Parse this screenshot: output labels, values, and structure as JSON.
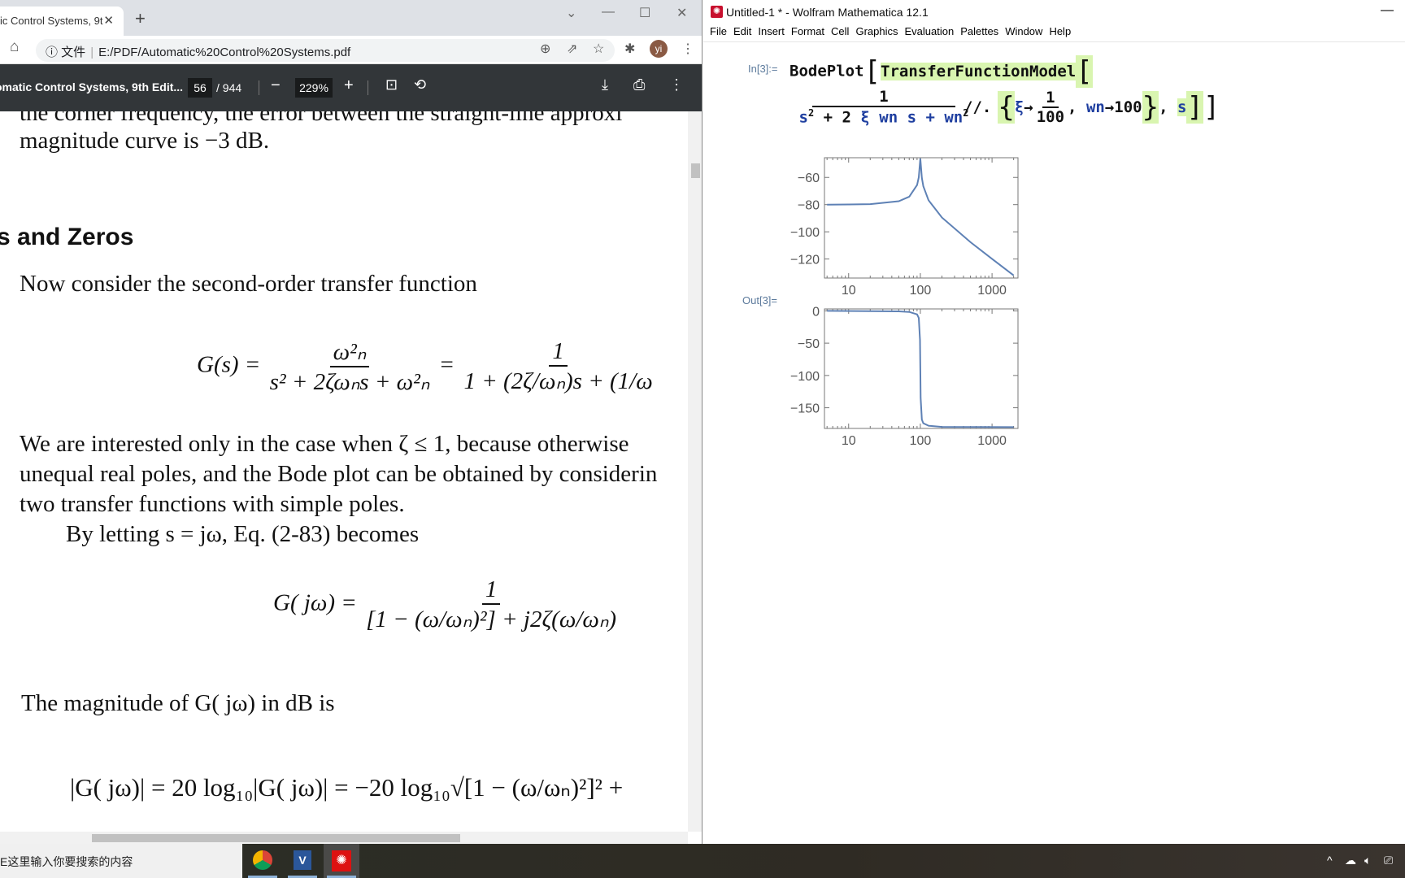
{
  "chrome": {
    "tab_title": "ic Control Systems, 9t",
    "new_tab": "+",
    "window_controls": [
      "⌄",
      "—",
      "☐",
      "✕"
    ],
    "address": {
      "info_icon": "info-icon",
      "label": "文件",
      "url": "E:/PDF/Automatic%20Control%20Systems.pdf"
    },
    "avatar": "yi",
    "pdf_toolbar": {
      "title": "omatic Control Systems, 9th Edit...",
      "page": "56",
      "total": "/ 944",
      "zoom": "229%",
      "minus": "−",
      "plus": "+"
    }
  },
  "pdf": {
    "line0": "the corner frequency, the error between the straight-line approxi",
    "line1": "magnitude curve is −3 dB.",
    "heading": "s and Zeros",
    "line2": "Now consider the second-order transfer function",
    "eq1": {
      "lhs": "G(s) =",
      "num1": "ω²ₙ",
      "den1": "s² + 2ζωₙs + ω²ₙ",
      "eq": "=",
      "num2": "1",
      "den2": "1 + (2ζ/ωₙ)s + (1/ω"
    },
    "para": [
      "We are interested only in the case when ζ ≤ 1, because otherwise",
      "unequal real poles, and the Bode plot can be obtained by considerin",
      "two transfer functions with simple poles."
    ],
    "line3": "By letting s = jω, Eq. (2-83) becomes",
    "eq2": {
      "lhs": "G( jω) =",
      "num": "1",
      "den": "[1 − (ω/ωₙ)²] + j2ζ(ω/ωₙ)"
    },
    "line4": "The magnitude of G( jω) in dB is",
    "eq3": "|G( jω)| = 20 log₁₀|G( jω)| = −20 log₁₀√[1 − (ω/ωₙ)²]² +"
  },
  "mathematica": {
    "title": "Untitled-1 * - Wolfram Mathematica 12.1",
    "menu": [
      "File",
      "Edit",
      "Insert",
      "Format",
      "Cell",
      "Graphics",
      "Evaluation",
      "Palettes",
      "Window",
      "Help"
    ],
    "in_label": "In[3]:=",
    "out_label": "Out[3]=",
    "input": {
      "fn": "BodePlot",
      "model": "TransferFunctionModel",
      "num": "1",
      "den_s": "s",
      "den_rest1": " + 2 ",
      "zeta": "ξ",
      "den_rest2": " wn s + wn",
      "sup": "2",
      "op": "//.",
      "rule1": "ξ",
      "arrow": "→",
      "r1num": "1",
      "r1den": "100",
      "wn": "wn",
      "wnval": "100",
      "s": "s",
      "sq": "2"
    }
  },
  "chart_data": [
    {
      "type": "line",
      "title": "",
      "xscale": "log",
      "xlim": [
        4.6,
        2300
      ],
      "ylim": [
        -134,
        -45.5
      ],
      "xticks": [
        "10",
        "100",
        "1000"
      ],
      "yticks": [
        "-60",
        "-80",
        "-100",
        "-120"
      ],
      "grid": false,
      "color": "#5e81b5",
      "x": [
        5,
        10,
        20,
        50,
        70,
        90,
        95,
        99,
        100,
        101,
        105,
        110,
        130,
        200,
        500,
        1000,
        2000
      ],
      "y": [
        -79.98,
        -79.91,
        -79.65,
        -77.5,
        -74.15,
        -65.61,
        -59.94,
        -48.97,
        -46.02,
        -49.1,
        -60.39,
        -66.49,
        -76.78,
        -89.54,
        -107.6,
        -119.9,
        -132.0
      ]
    },
    {
      "type": "line",
      "title": "",
      "xscale": "log",
      "xlim": [
        4.6,
        2300
      ],
      "ylim": [
        -182,
        3
      ],
      "xticks": [
        "10",
        "100",
        "1000"
      ],
      "yticks": [
        "0",
        "-50",
        "-100",
        "-150"
      ],
      "grid": false,
      "color": "#5e81b5",
      "x": [
        5,
        50,
        70,
        90,
        95,
        99,
        100,
        101,
        105,
        110,
        130,
        200,
        2000
      ],
      "y": [
        0,
        -0.8,
        -1.6,
        -5.4,
        -11.0,
        -44.9,
        -90,
        -134.9,
        -168.4,
        -174.0,
        -177.8,
        -179.6,
        -180
      ]
    }
  ],
  "taskbar": {
    "search_placeholder": "E这里输入你要搜索的内容",
    "apps": [
      "chrome",
      "visio",
      "mathematica"
    ]
  }
}
